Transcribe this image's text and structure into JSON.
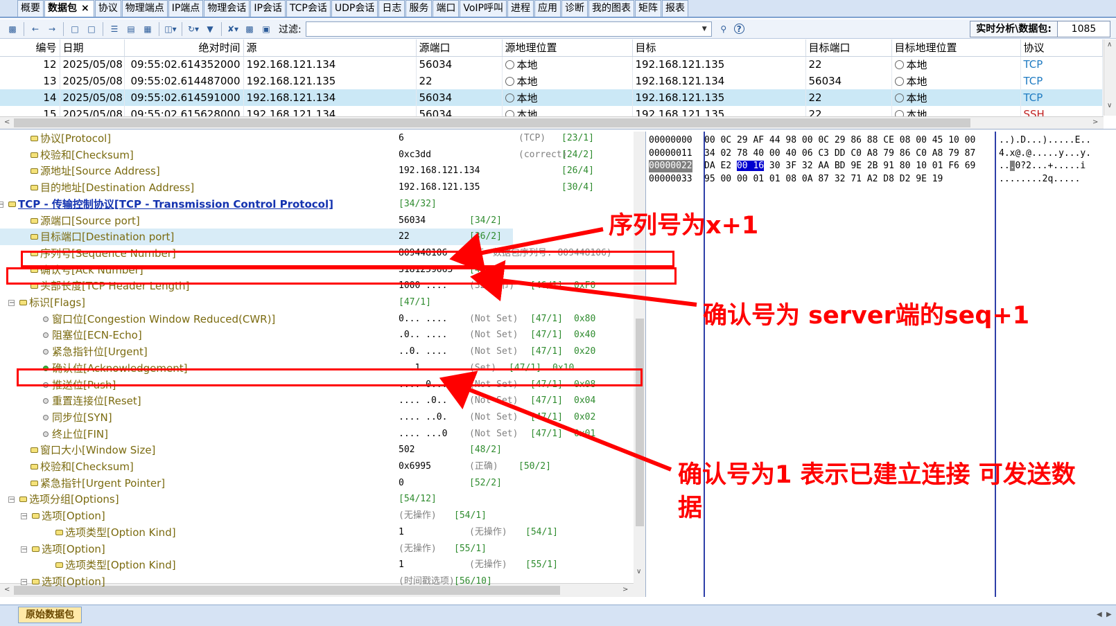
{
  "tabs": [
    {
      "label": "概要",
      "active": false
    },
    {
      "label": "数据包",
      "active": true
    },
    {
      "label": "协议",
      "active": false
    },
    {
      "label": "物理端点",
      "active": false
    },
    {
      "label": "IP端点",
      "active": false
    },
    {
      "label": "物理会话",
      "active": false
    },
    {
      "label": "IP会话",
      "active": false
    },
    {
      "label": "TCP会话",
      "active": false
    },
    {
      "label": "UDP会话",
      "active": false
    },
    {
      "label": "日志",
      "active": false
    },
    {
      "label": "服务",
      "active": false
    },
    {
      "label": "端口",
      "active": false
    },
    {
      "label": "VoIP呼叫",
      "active": false
    },
    {
      "label": "进程",
      "active": false
    },
    {
      "label": "应用",
      "active": false
    },
    {
      "label": "诊断",
      "active": false
    },
    {
      "label": "我的图表",
      "active": false
    },
    {
      "label": "矩阵",
      "active": false
    },
    {
      "label": "报表",
      "active": false
    }
  ],
  "tab_close": "×",
  "toolbar": {
    "filter_label": "过滤:",
    "filter_value": "",
    "stat_label": "实时分析\\数据包:",
    "stat_value": "1085"
  },
  "packet_table": {
    "columns": [
      "编号",
      "日期",
      "绝对时间",
      "源",
      "源端口",
      "源地理位置",
      "目标",
      "目标端口",
      "目标地理位置",
      "协议"
    ],
    "rows": [
      {
        "num": "12",
        "date": "2025/05/08",
        "time": "09:55:02.614352000",
        "src": "192.168.121.134",
        "sport": "56034",
        "sgeo": "本地",
        "dst": "192.168.121.135",
        "dport": "22",
        "dgeo": "本地",
        "proto": "TCP",
        "selected": false
      },
      {
        "num": "13",
        "date": "2025/05/08",
        "time": "09:55:02.614487000",
        "src": "192.168.121.135",
        "sport": "22",
        "sgeo": "本地",
        "dst": "192.168.121.134",
        "dport": "56034",
        "dgeo": "本地",
        "proto": "TCP",
        "selected": false
      },
      {
        "num": "14",
        "date": "2025/05/08",
        "time": "09:55:02.614591000",
        "src": "192.168.121.134",
        "sport": "56034",
        "sgeo": "本地",
        "dst": "192.168.121.135",
        "dport": "22",
        "dgeo": "本地",
        "proto": "TCP",
        "selected": true
      },
      {
        "num": "15",
        "date": "2025/05/08",
        "time": "09:55:02.615628000",
        "src": "192.168.121.134",
        "sport": "56034",
        "sgeo": "本地",
        "dst": "192.168.121.135",
        "dport": "22",
        "dgeo": "本地",
        "proto": "SSH",
        "selected": false
      }
    ]
  },
  "decode_tree": [
    {
      "label": "协议[Protocol]",
      "value": "6",
      "note": "(TCP)",
      "off": "[23/1]",
      "hex": "",
      "type": "field"
    },
    {
      "label": "校验和[Checksum]",
      "value": "0xc3dd",
      "note": "(correct)",
      "off": "[24/2]",
      "hex": "",
      "type": "field"
    },
    {
      "label": "源地址[Source Address]",
      "value": "192.168.121.134",
      "note": "",
      "off": "[26/4]",
      "hex": "",
      "type": "addr"
    },
    {
      "label": "目的地址[Destination Address]",
      "value": "192.168.121.135",
      "note": "",
      "off": "[30/4]",
      "hex": "",
      "type": "addr"
    },
    {
      "label": "TCP - 传输控制协议[TCP - Transmission Control Protocol]",
      "value": "",
      "note": "",
      "off": "[34/32]",
      "hex": "",
      "type": "header"
    },
    {
      "label": "源端口[Source port]",
      "value": "56034",
      "note": "",
      "off": "[34/2]",
      "hex": "",
      "type": "field"
    },
    {
      "label": "目标端口[Destination port]",
      "value": "22",
      "note": "",
      "off": "[36/2]",
      "hex": "",
      "type": "field"
    },
    {
      "label": "序列号[Sequence Number]",
      "value": "809448106",
      "note": "(下一数据包序列号: 809448106)",
      "off": "",
      "hex": "",
      "type": "field"
    },
    {
      "label": "确认号[Ack Number]",
      "value": "3181259665",
      "note": "",
      "off": "[42/4]",
      "hex": "",
      "type": "field"
    },
    {
      "label": "头部长度[TCP Header Length]",
      "value": "1000 ....",
      "note": "(32 字节)",
      "off": "[46/1]",
      "hex": "0xF0",
      "type": "field"
    },
    {
      "label": "标识[Flags]",
      "value": "",
      "note": "",
      "off": "[47/1]",
      "hex": "",
      "type": "group"
    },
    {
      "label": "窗口位[Congestion Window Reduced(CWR)]",
      "value": "0... ....",
      "note": "(Not Set)",
      "off": "[47/1]",
      "hex": "0x80",
      "type": "flag"
    },
    {
      "label": "阻塞位[ECN-Echo]",
      "value": ".0.. ....",
      "note": "(Not Set)",
      "off": "[47/1]",
      "hex": "0x40",
      "type": "flag"
    },
    {
      "label": "紧急指针位[Urgent]",
      "value": "..0. ....",
      "note": "(Not Set)",
      "off": "[47/1]",
      "hex": "0x20",
      "type": "flag"
    },
    {
      "label": "确认位[Acknowledgement]",
      "value": "...1 ....",
      "note": "(Set)",
      "off": "[47/1]",
      "hex": "0x10",
      "type": "flagon"
    },
    {
      "label": "推送位[Push]",
      "value": ".... 0...",
      "note": "(Not Set)",
      "off": "[47/1]",
      "hex": "0x08",
      "type": "flag"
    },
    {
      "label": "重置连接位[Reset]",
      "value": ".... .0..",
      "note": "(Not Set)",
      "off": "[47/1]",
      "hex": "0x04",
      "type": "flag"
    },
    {
      "label": "同步位[SYN]",
      "value": ".... ..0.",
      "note": "(Not Set)",
      "off": "[47/1]",
      "hex": "0x02",
      "type": "flag"
    },
    {
      "label": "终止位[FIN]",
      "value": ".... ...0",
      "note": "(Not Set)",
      "off": "[47/1]",
      "hex": "0x01",
      "type": "flag"
    },
    {
      "label": "窗口大小[Window Size]",
      "value": "502",
      "note": "",
      "off": "[48/2]",
      "hex": "",
      "type": "field"
    },
    {
      "label": "校验和[Checksum]",
      "value": "0x6995",
      "note": "(正确)",
      "off": "[50/2]",
      "hex": "",
      "type": "field"
    },
    {
      "label": "紧急指针[Urgent Pointer]",
      "value": "0",
      "note": "",
      "off": "[52/2]",
      "hex": "",
      "type": "field"
    },
    {
      "label": "选项分组[Options]",
      "value": "",
      "note": "",
      "off": "[54/12]",
      "hex": "",
      "type": "group"
    },
    {
      "label": "选项[Option]",
      "value": "",
      "note": "(无操作)",
      "off": "[54/1]",
      "hex": "",
      "type": "group"
    },
    {
      "label": "选项类型[Option Kind]",
      "value": "1",
      "note": "(无操作)",
      "off": "[54/1]",
      "hex": "",
      "type": "field"
    },
    {
      "label": "选项[Option]",
      "value": "",
      "note": "(无操作)",
      "off": "[55/1]",
      "hex": "",
      "type": "group"
    },
    {
      "label": "选项类型[Option Kind]",
      "value": "1",
      "note": "(无操作)",
      "off": "[55/1]",
      "hex": "",
      "type": "field"
    },
    {
      "label": "选项[Option]",
      "value": "",
      "note": "(时间戳选项)",
      "off": "[56/10]",
      "hex": "",
      "type": "group"
    }
  ],
  "hex_dump": [
    {
      "offset": "00000000",
      "bytes": "00 0C 29 AF 44 98 00 0C 29 86 88 CE 08 00 45 10 00",
      "ascii": "..).D...).....E.."
    },
    {
      "offset": "00000011",
      "bytes": "34 02 78 40 00 40 06 C3 DD C0 A8 79 86 C0 A8 79 87",
      "ascii": "4.x@.@.....y...y."
    },
    {
      "offset": "00000022",
      "bytes_pre": "DA E2 ",
      "bytes_hl": "00 16",
      "bytes_post": " 30 3F 32 AA BD 9E 2B 91 80 10 01 F6 69",
      "ascii_pre": "..",
      "ascii_hl": ".",
      "ascii_post": "0?2...+.....i"
    },
    {
      "offset": "00000033",
      "bytes": "95 00 00 01 01 08 0A 87 32 71 A2 D8 D2 9E 19",
      "ascii": "........2q....."
    }
  ],
  "bottom_tab": "原始数据包",
  "annotations": {
    "seq": "序列号为x+1",
    "ack": "确认号为 server端的seq+1",
    "ackflag_line1": "确认号为1 表示已建立连接 可发送数",
    "ackflag_line2": "据"
  },
  "colors": {
    "annotation": "#ff0000",
    "selected_row": "#cbe8f6",
    "tree_label": "#7b6b10",
    "offset_green": "#2e8b2e",
    "proto_tcp": "#1f7bc2",
    "proto_ssh": "#c02020"
  }
}
